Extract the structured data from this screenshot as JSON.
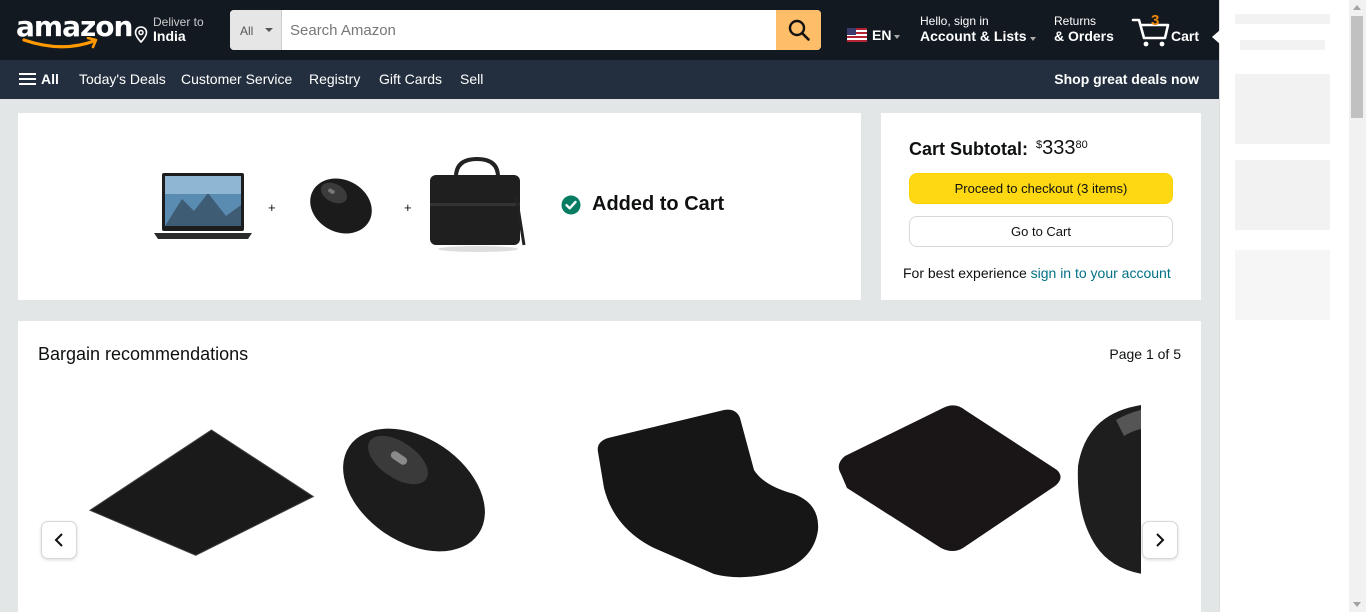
{
  "header": {
    "logo": "amazon",
    "deliver_line1": "Deliver to",
    "deliver_line2": "India",
    "search_category": "All",
    "search_placeholder": "Search Amazon",
    "language": "EN",
    "account_line1": "Hello, sign in",
    "account_line2": "Account & Lists",
    "returns_line1": "Returns",
    "returns_line2": "& Orders",
    "cart_count": "3",
    "cart_label": "Cart"
  },
  "subnav": {
    "all": "All",
    "items": [
      "Today's Deals",
      "Customer Service",
      "Registry",
      "Gift Cards",
      "Sell"
    ],
    "promo": "Shop great deals now"
  },
  "added": {
    "plus": "+",
    "message": "Added to Cart",
    "products": [
      "laptop",
      "wireless mouse",
      "laptop bag"
    ]
  },
  "subtotal": {
    "label": "Cart Subtotal:",
    "currency": "$",
    "whole": "333",
    "fraction": "80",
    "checkout_button": "Proceed to checkout (3 items)",
    "cart_button": "Go to Cart",
    "best_text": "For best experience",
    "sign_in_link": "sign in to your account"
  },
  "recommendations": {
    "title": "Bargain recommendations",
    "page": "Page 1 of 5",
    "items": [
      "mouse pad",
      "wireless mouse",
      "gel mouse pad",
      "mouse pad",
      "wireless mouse"
    ]
  },
  "colors": {
    "nav_dark": "#131921",
    "nav_sub": "#232f3e",
    "search_button": "#febd69",
    "checkout_yellow": "#ffd814",
    "link_teal": "#007185",
    "cart_count_orange": "#f08804",
    "success_green": "#067d62"
  }
}
